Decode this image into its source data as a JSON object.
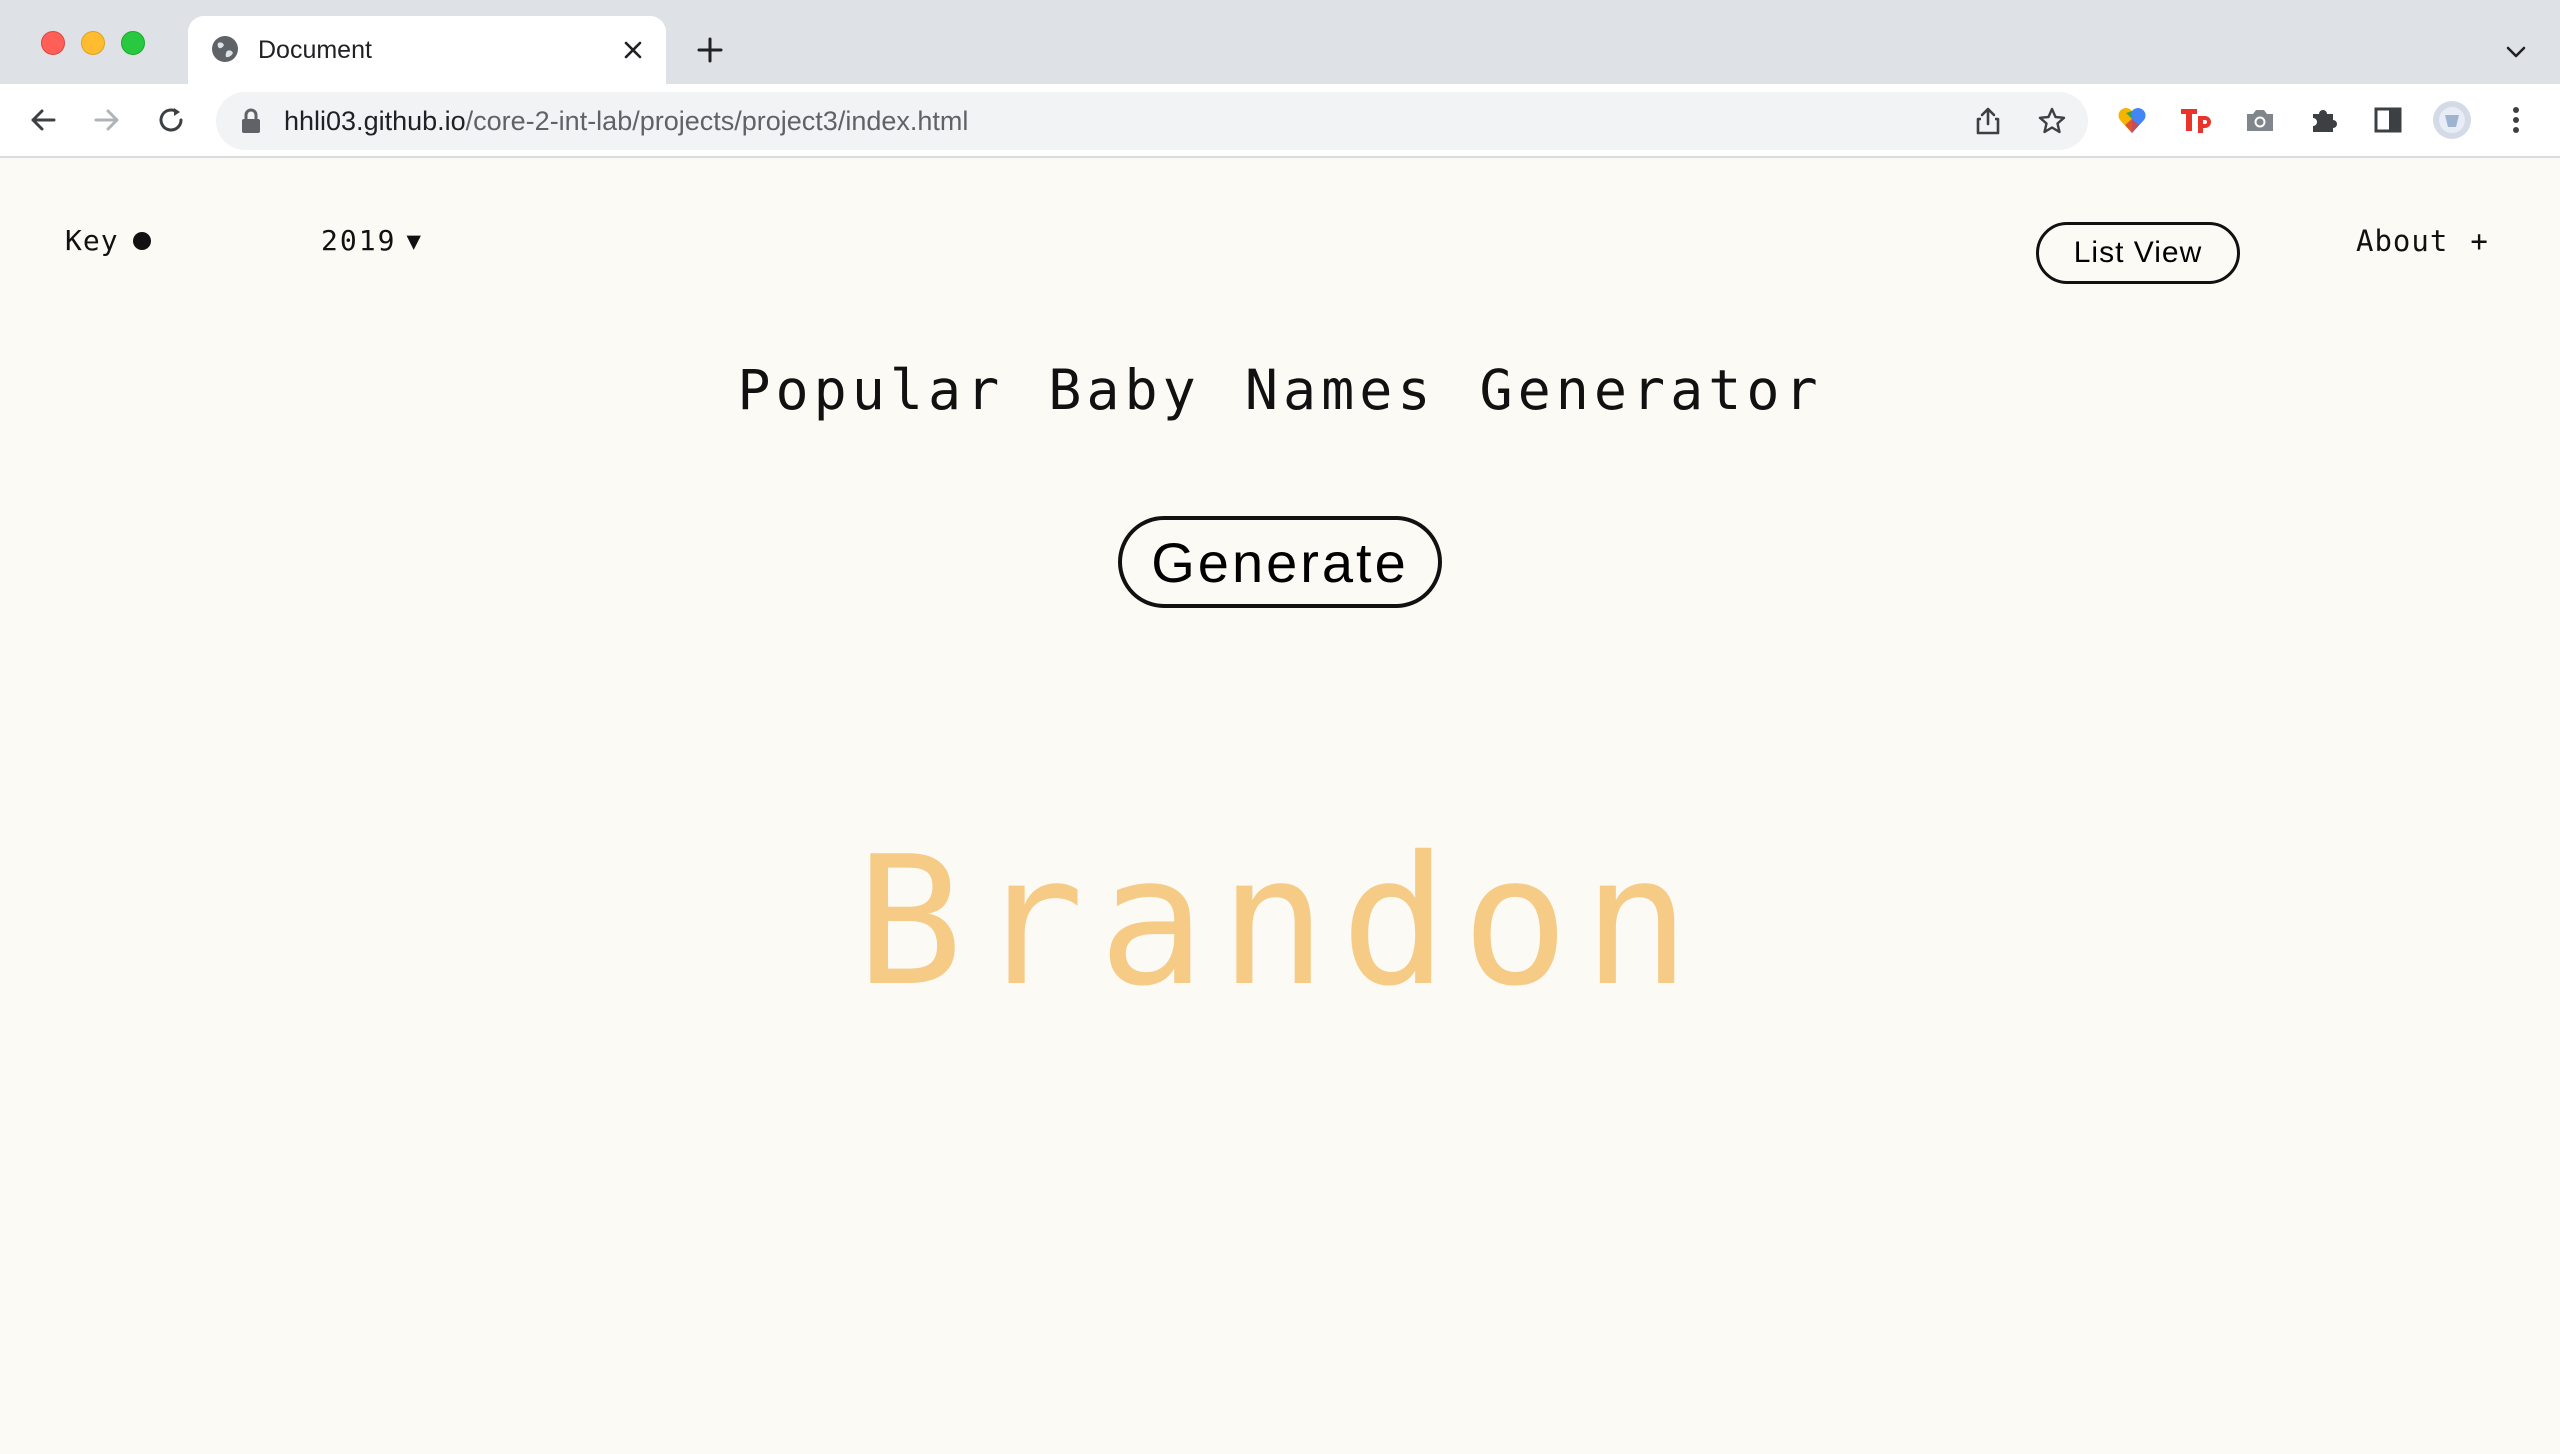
{
  "browser": {
    "tab_title": "Document",
    "url_host": "hhli03.github.io",
    "url_path": "/core-2-int-lab/projects/project3/index.html"
  },
  "nav": {
    "key_label": "Key",
    "year": "2019",
    "year_caret": "▼",
    "list_view_label": "List View",
    "about_label": "About",
    "about_plus": "+"
  },
  "main": {
    "title": "Popular Baby Names Generator",
    "generate_label": "Generate",
    "generated_name": "Brandon"
  },
  "colors": {
    "name_color": "#f5cb85",
    "background": "#fbfaf5"
  }
}
